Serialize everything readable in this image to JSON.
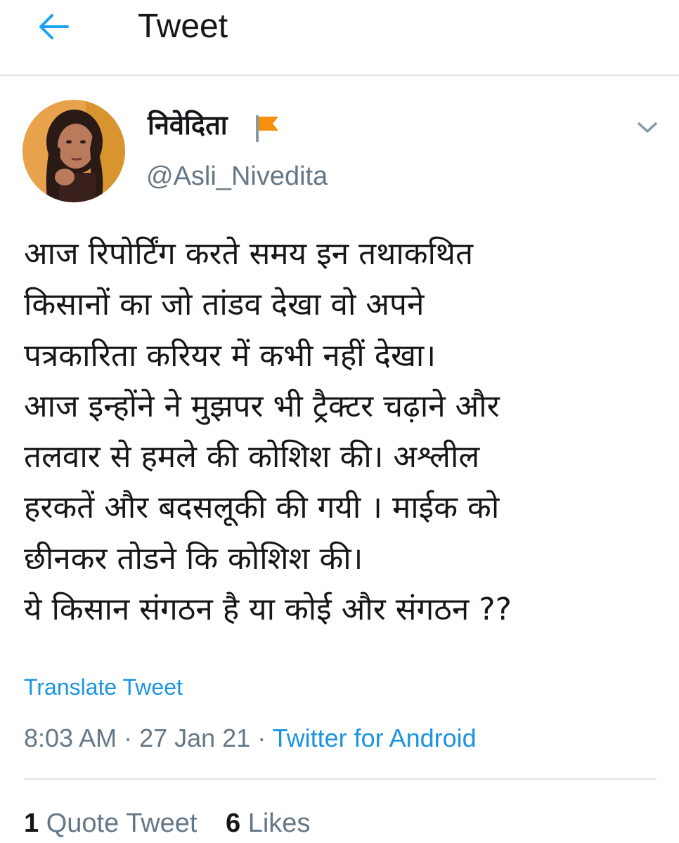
{
  "header": {
    "title": "Tweet",
    "back_icon": "back-arrow-icon",
    "accent": "#1da1f2"
  },
  "author": {
    "display_name": "निवेदिता",
    "flag_icon": "saffron-flag-icon",
    "handle": "@Asli_Nivedita",
    "caret_icon": "chevron-down-icon"
  },
  "tweet": {
    "lines": [
      "आज रिपोर्टिंग करते समय इन तथाकथित",
      "किसानों का जो तांडव देखा वो अपने",
      "पत्रकारिता करियर में कभी नहीं देखा।",
      "आज इन्होंने ने मुझपर भी ट्रैक्टर चढ़ाने और",
      "तलवार से हमले की कोशिश की। अश्लील",
      "हरकतें और बदसलूकी की गयी । माईक को",
      "छीनकर तोडने कि कोशिश की।",
      "ये किसान संगठन है या कोई और संगठन ??"
    ],
    "translate_label": "Translate Tweet"
  },
  "meta": {
    "time": "8:03 AM",
    "separator": " · ",
    "date": "27 Jan 21",
    "source": "Twitter for Android"
  },
  "stats": {
    "quote_count": "1",
    "quote_label": " Quote Tweet",
    "likes_count": "6",
    "likes_label": " Likes"
  },
  "colors": {
    "text": "#14171a",
    "secondary": "#657786",
    "link": "#1b95e0",
    "divider": "#e1e8ed",
    "flag": "#f4900c"
  }
}
